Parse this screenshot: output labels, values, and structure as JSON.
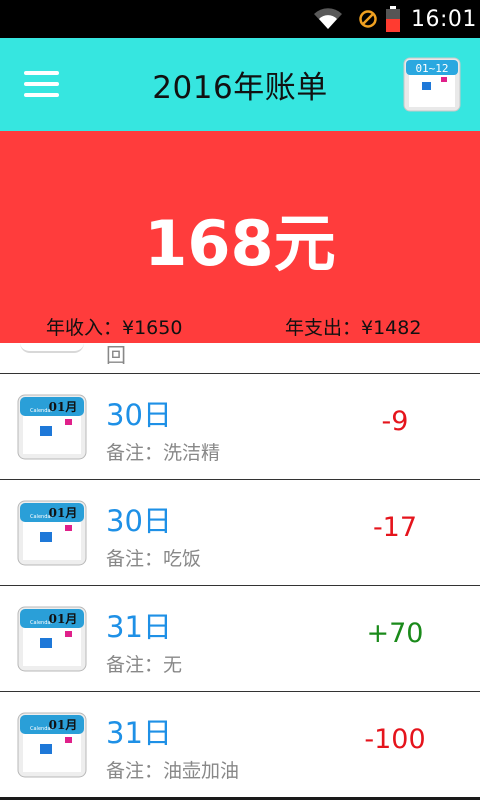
{
  "status_bar": {
    "time": "16:01",
    "icons": [
      "wifi-icon",
      "dnd-icon",
      "battery-icon"
    ]
  },
  "header": {
    "title": "2016年账单",
    "calendar_badge": "01~12",
    "menu_icon": "menu-icon",
    "calendar_icon": "calendar-range-icon"
  },
  "summary": {
    "total": "168元",
    "income": "年收入：¥1650",
    "expense": "年支出：¥1482"
  },
  "partial_row": {
    "text": "回"
  },
  "records": [
    {
      "date": "30日",
      "note": "备注：洗洁精",
      "amount": "-9",
      "type": "expense"
    },
    {
      "date": "30日",
      "note": "备注：吃饭",
      "amount": "-17",
      "type": "expense"
    },
    {
      "date": "31日",
      "note": "备注：无",
      "amount": "+70",
      "type": "income"
    },
    {
      "date": "31日",
      "note": "备注：油壶加油",
      "amount": "-100",
      "type": "expense"
    }
  ],
  "calendar_icon_label": {
    "month": "01月",
    "caption": "Calendar"
  },
  "colors": {
    "header_bg": "#36e6e0",
    "summary_bg": "#ff3c3c",
    "date_text": "#1e90e6",
    "expense": "#e5141c",
    "income": "#1a8a1a"
  }
}
